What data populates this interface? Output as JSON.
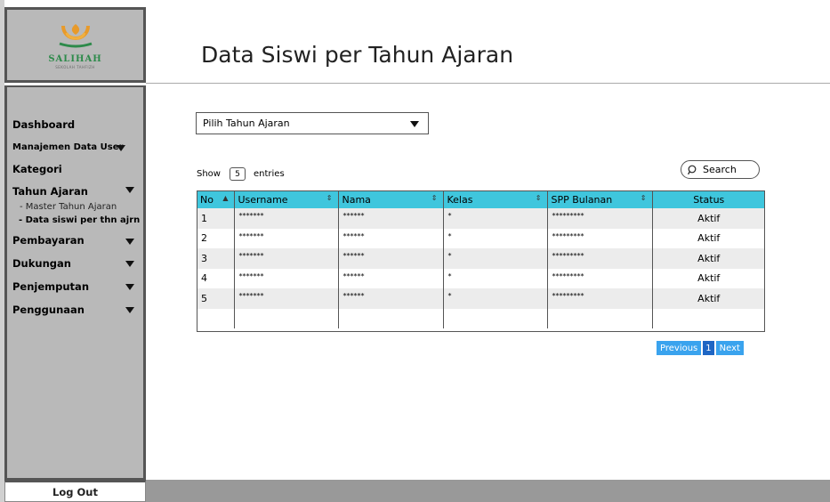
{
  "logo": {
    "text": "SALIHAH",
    "subtext": "SEKOLAH TAHFIZH"
  },
  "sidebar": {
    "items": [
      {
        "label": "Dashboard",
        "has_arrow": false
      },
      {
        "label": "Manajemen Data User",
        "has_arrow": true
      },
      {
        "label": "Kategori",
        "has_arrow": false
      },
      {
        "label": "Tahun Ajaran",
        "has_arrow": true
      },
      {
        "label": "Pembayaran",
        "has_arrow": true
      },
      {
        "label": "Dukungan",
        "has_arrow": true
      },
      {
        "label": "Penjemputan",
        "has_arrow": true
      },
      {
        "label": "Penggunaan",
        "has_arrow": true
      }
    ],
    "sub_items": [
      {
        "label": "- Master Tahun Ajaran",
        "active": false
      },
      {
        "label": "- Data siswi per thn ajrn",
        "active": true
      }
    ],
    "logout_label": "Log Out"
  },
  "main": {
    "title": "Data Siswi per Tahun Ajaran",
    "select_placeholder": "Pilih Tahun Ajaran",
    "show_label": "Show",
    "show_value": "5",
    "entries_label": "entries",
    "search_label": "Search"
  },
  "table": {
    "headers": [
      "No",
      "Username",
      "Nama",
      "Kelas",
      "SPP Bulanan",
      "Status"
    ],
    "rows": [
      [
        "1",
        "*******",
        "******",
        "*",
        "*********",
        "Aktif"
      ],
      [
        "2",
        "*******",
        "******",
        "*",
        "*********",
        "Aktif"
      ],
      [
        "3",
        "*******",
        "******",
        "*",
        "*********",
        "Aktif"
      ],
      [
        "4",
        "*******",
        "******",
        "*",
        "*********",
        "Aktif"
      ],
      [
        "5",
        "*******",
        "******",
        "*",
        "*********",
        "Aktif"
      ],
      [
        "",
        "",
        "",
        "",
        "",
        ""
      ]
    ]
  },
  "pagination": {
    "previous": "Previous",
    "page": "1",
    "next": "Next"
  },
  "colors": {
    "sidebar_bg": "#b9b9b9",
    "header_accent": "#3fc6dd",
    "pager_button": "#3aa3ee",
    "logo_green": "#2d8a4a",
    "logo_orange": "#e89a2a"
  }
}
